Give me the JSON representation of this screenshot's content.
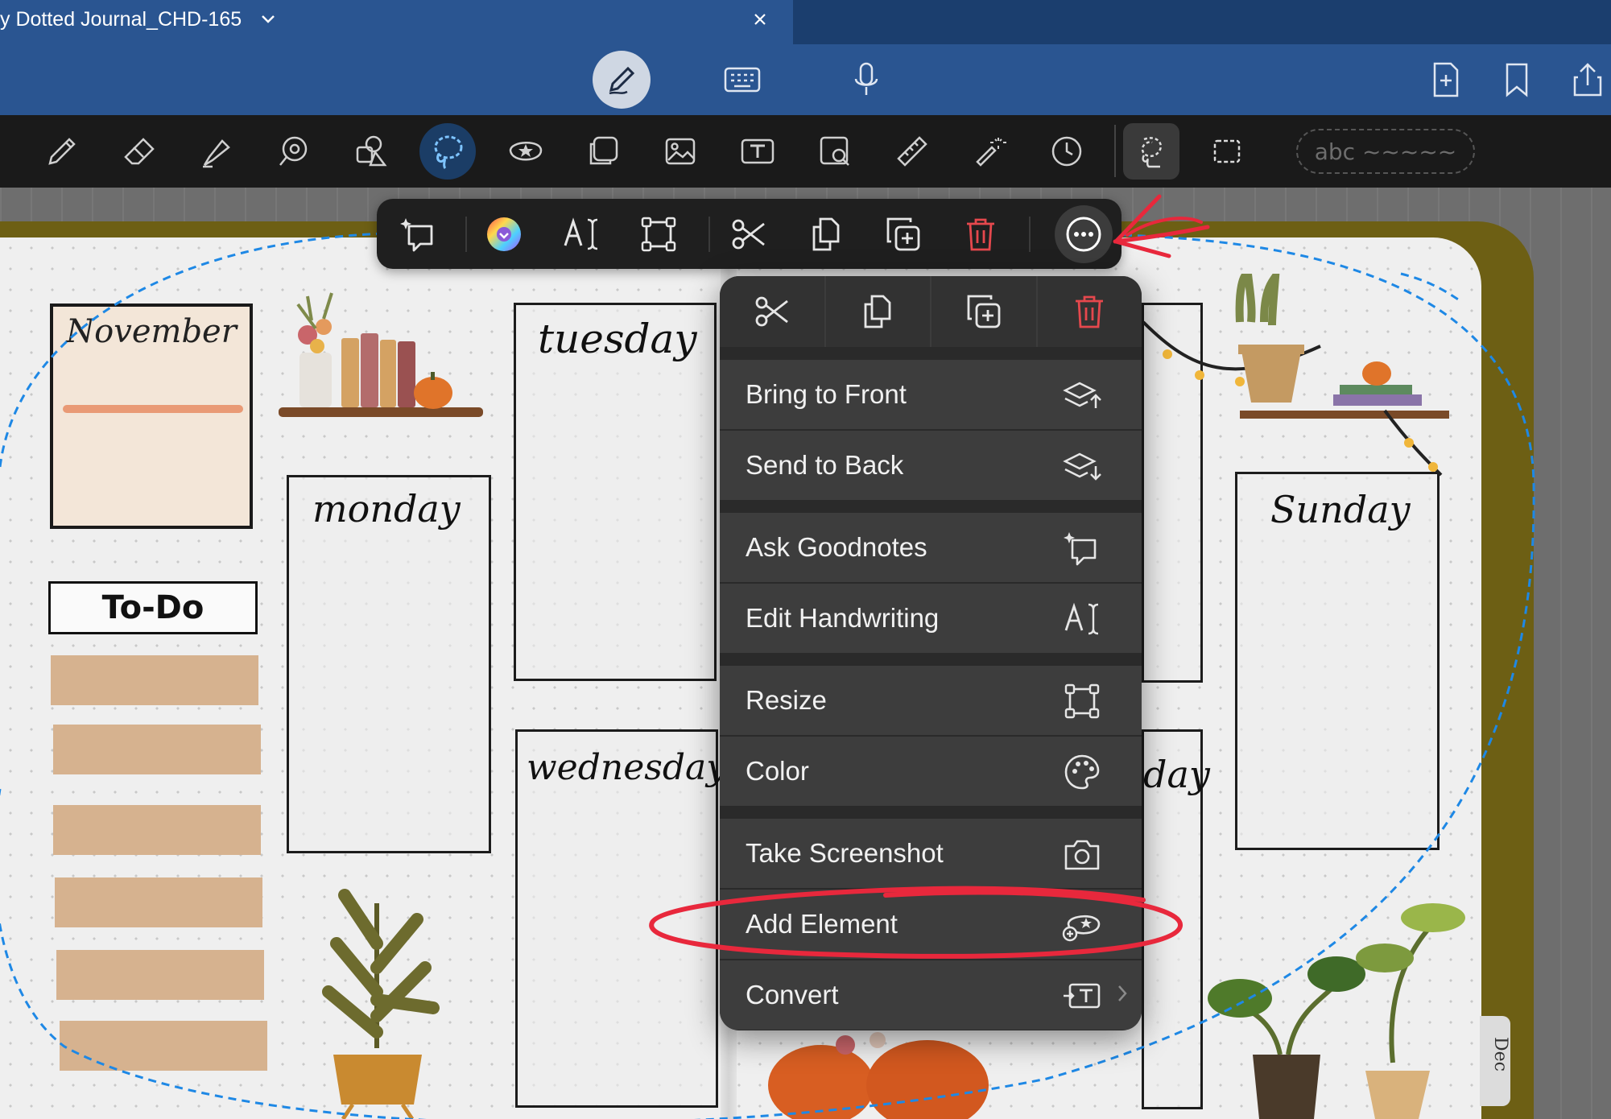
{
  "tabbar": {
    "title": "y Dotted Journal_CHD-165"
  },
  "journal": {
    "calendar_month": "November",
    "todo_label": "To-Do",
    "days": {
      "tuesday": "tuesday",
      "monday": "monday",
      "wednesday": "wednesday",
      "sunday": "Sunday",
      "partial_day": "day"
    },
    "page_tab": "Dec"
  },
  "toolbar": {
    "handwriting_chip": "abc ~~~~~"
  },
  "context_menu": {
    "items": [
      {
        "label": "Bring to Front",
        "icon": "bring-to-front-icon"
      },
      {
        "label": "Send to Back",
        "icon": "send-to-back-icon"
      },
      {
        "label": "Ask Goodnotes",
        "icon": "ask-goodnotes-icon"
      },
      {
        "label": "Edit Handwriting",
        "icon": "edit-handwriting-icon"
      },
      {
        "label": "Resize",
        "icon": "resize-icon"
      },
      {
        "label": "Color",
        "icon": "palette-icon"
      },
      {
        "label": "Take Screenshot",
        "icon": "camera-icon"
      },
      {
        "label": "Add Element",
        "icon": "add-element-icon"
      },
      {
        "label": "Convert",
        "icon": "convert-text-icon"
      }
    ]
  },
  "colors": {
    "brand_blue": "#2a5591",
    "toolbar_dark": "#1a1a1a",
    "menu_bg": "#3d3d3d",
    "delete_red": "#e5484d",
    "annotation_red": "#e8283c",
    "lasso_blue": "#1e88e5"
  }
}
